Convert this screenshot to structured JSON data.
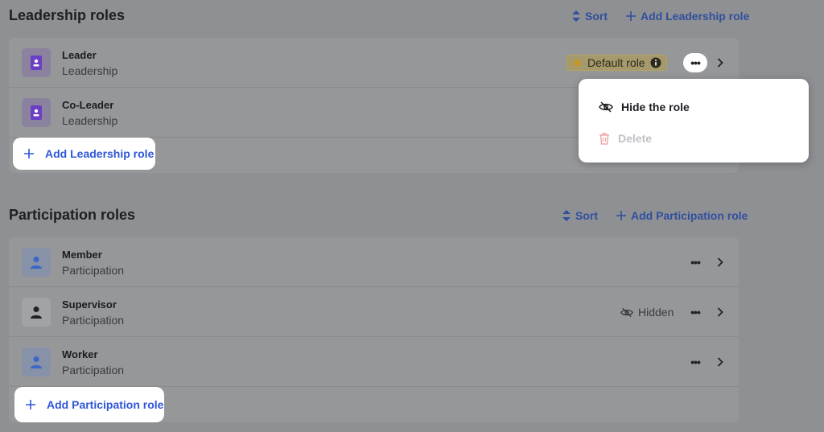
{
  "leadership": {
    "title": "Leadership roles",
    "sort_label": "Sort",
    "add_label": "Add Leadership role",
    "rows": [
      {
        "name": "Leader",
        "category": "Leadership",
        "badge": "Default role"
      },
      {
        "name": "Co-Leader",
        "category": "Leadership"
      }
    ],
    "add_row_label": "Add Leadership role"
  },
  "participation": {
    "title": "Participation roles",
    "sort_label": "Sort",
    "add_label": "Add Participation role",
    "rows": [
      {
        "name": "Member",
        "category": "Participation"
      },
      {
        "name": "Supervisor",
        "category": "Participation",
        "status": "Hidden"
      },
      {
        "name": "Worker",
        "category": "Participation"
      }
    ],
    "add_row_label": "Add Participation role"
  },
  "context_menu": {
    "items": [
      {
        "label": "Hide the role",
        "icon": "eye-slash-icon",
        "enabled": true
      },
      {
        "label": "Delete",
        "icon": "trash-icon",
        "enabled": false
      }
    ]
  },
  "more_label": "•••",
  "colors": {
    "accent": "#2f56d8",
    "leader_icon": "#6b3fc4",
    "participation_icon": "#3b67c9",
    "badge_star": "#c8961e"
  }
}
